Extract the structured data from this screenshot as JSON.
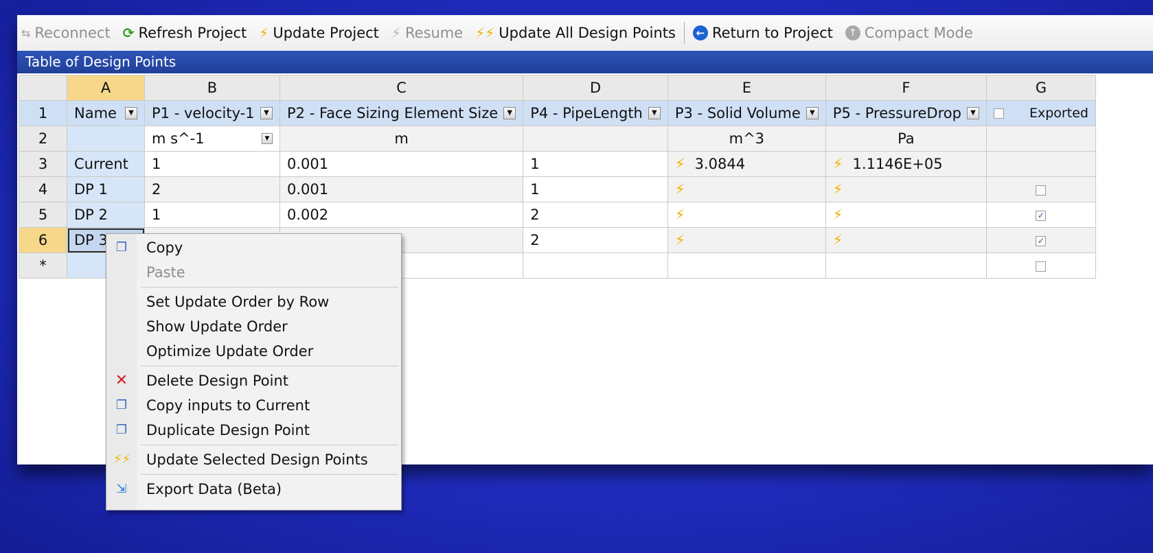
{
  "toolbar": {
    "reconnect": "Reconnect",
    "refresh_project": "Refresh Project",
    "update_project": "Update Project",
    "resume": "Resume",
    "update_all": "Update All Design Points",
    "return_to_project": "Return to Project",
    "compact_mode": "Compact Mode"
  },
  "table": {
    "title": "Table of Design Points",
    "columns": [
      "A",
      "B",
      "C",
      "D",
      "E",
      "F",
      "G"
    ],
    "row_numbers": [
      "1",
      "2",
      "3",
      "4",
      "5",
      "6",
      "*"
    ],
    "headers": {
      "a": "Name",
      "b": "P1 - velocity-1",
      "c": "P2 - Face Sizing Element Size",
      "d": "P4 - PipeLength",
      "e": "P3 - Solid Volume",
      "f": "P5 - PressureDrop",
      "g": "Exported"
    },
    "units": {
      "b": "m s^-1",
      "c": "m",
      "e": "m^3",
      "f": "Pa"
    },
    "rows": [
      {
        "name": "Current",
        "p1": "1",
        "p2": "0.001",
        "p4": "1",
        "p3": "3.0844",
        "p5": "1.1146E+05",
        "exported": null
      },
      {
        "name": "DP 1",
        "p1": "2",
        "p2": "0.001",
        "p4": "1",
        "p3": "",
        "p5": "",
        "exported": false
      },
      {
        "name": "DP 2",
        "p1": "1",
        "p2": "0.002",
        "p4": "2",
        "p3": "",
        "p5": "",
        "exported": true
      },
      {
        "name": "DP 3",
        "p1": "",
        "p2": "",
        "p4": "2",
        "p3": "",
        "p5": "",
        "exported": true
      }
    ],
    "new_row_exported": false,
    "checkmark": "✓",
    "bolt_icon": "⚡"
  },
  "context_menu": {
    "copy": "Copy",
    "paste": "Paste",
    "set_update_order": "Set Update Order by Row",
    "show_update_order": "Show Update Order",
    "optimize_update_order": "Optimize Update Order",
    "delete_design_point": "Delete Design Point",
    "copy_inputs": "Copy inputs to Current",
    "duplicate_design_point": "Duplicate Design Point",
    "update_selected": "Update Selected Design Points",
    "export_data": "Export Data (Beta)"
  },
  "colors": {
    "background": "#2230c6",
    "title_bar": "#2a4aa8",
    "selected_header": "#f7d78a",
    "param_header": "#cfe0f5",
    "bolt": "#f0b400"
  }
}
